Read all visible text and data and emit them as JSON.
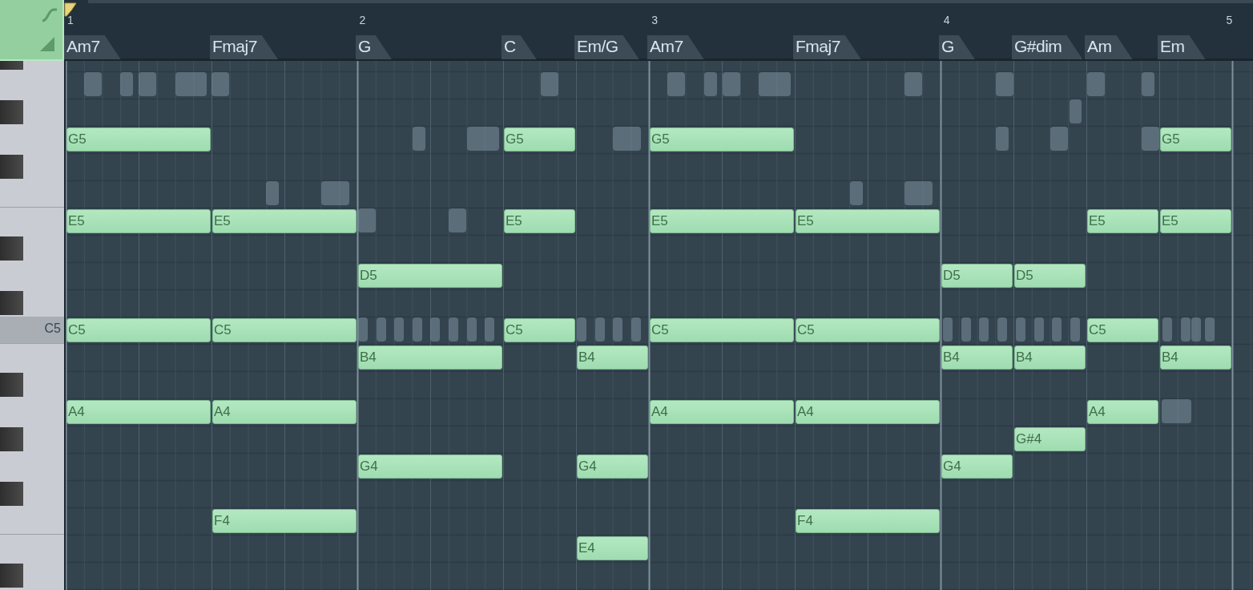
{
  "timeline": {
    "bar_numbers": [
      "1",
      "2",
      "3",
      "4",
      "5"
    ]
  },
  "keyboard": {
    "key_label": "C5"
  },
  "chords": [
    {
      "label": "Am7",
      "notes": [
        {
          "label": "G5"
        },
        {
          "label": "E5"
        },
        {
          "label": "C5"
        },
        {
          "label": "A4"
        }
      ]
    },
    {
      "label": "Fmaj7",
      "notes": [
        {
          "label": "E5"
        },
        {
          "label": "C5"
        },
        {
          "label": "A4"
        },
        {
          "label": "F4"
        }
      ]
    },
    {
      "label": "G",
      "notes": [
        {
          "label": "D5"
        },
        {
          "label": "B4"
        },
        {
          "label": "G4"
        }
      ]
    },
    {
      "label": "C",
      "notes": [
        {
          "label": "G5"
        },
        {
          "label": "E5"
        },
        {
          "label": "C5"
        }
      ]
    },
    {
      "label": "Em/G",
      "notes": [
        {
          "label": "B4"
        },
        {
          "label": "G4"
        },
        {
          "label": "E4"
        }
      ]
    },
    {
      "label": "Am7",
      "notes": [
        {
          "label": "G5"
        },
        {
          "label": "E5"
        },
        {
          "label": "C5"
        },
        {
          "label": "A4"
        }
      ]
    },
    {
      "label": "Fmaj7",
      "notes": [
        {
          "label": "E5"
        },
        {
          "label": "C5"
        },
        {
          "label": "A4"
        },
        {
          "label": "F4"
        }
      ]
    },
    {
      "label": "G",
      "notes": [
        {
          "label": "D5"
        },
        {
          "label": "B4"
        },
        {
          "label": "G4"
        }
      ]
    },
    {
      "label": "G#dim",
      "notes": [
        {
          "label": "D5"
        },
        {
          "label": "B4"
        },
        {
          "label": "G#4"
        }
      ]
    },
    {
      "label": "Am",
      "notes": [
        {
          "label": "E5"
        },
        {
          "label": "C5"
        },
        {
          "label": "A4"
        }
      ]
    },
    {
      "label": "Em",
      "notes": [
        {
          "label": "G5"
        },
        {
          "label": "E5"
        },
        {
          "label": "B4"
        }
      ]
    }
  ]
}
